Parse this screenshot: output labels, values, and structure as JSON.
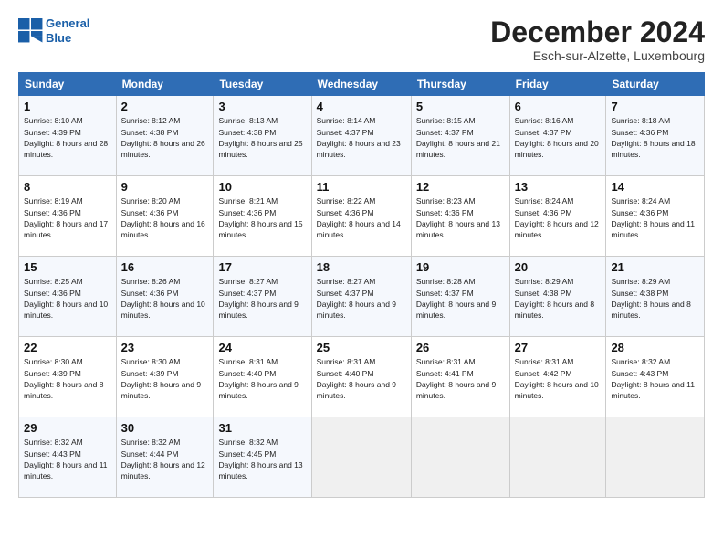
{
  "logo": {
    "line1": "General",
    "line2": "Blue"
  },
  "title": "December 2024",
  "subtitle": "Esch-sur-Alzette, Luxembourg",
  "days_of_week": [
    "Sunday",
    "Monday",
    "Tuesday",
    "Wednesday",
    "Thursday",
    "Friday",
    "Saturday"
  ],
  "weeks": [
    [
      {
        "day": "1",
        "sunrise": "8:10 AM",
        "sunset": "4:39 PM",
        "daylight": "8 hours and 28 minutes."
      },
      {
        "day": "2",
        "sunrise": "8:12 AM",
        "sunset": "4:38 PM",
        "daylight": "8 hours and 26 minutes."
      },
      {
        "day": "3",
        "sunrise": "8:13 AM",
        "sunset": "4:38 PM",
        "daylight": "8 hours and 25 minutes."
      },
      {
        "day": "4",
        "sunrise": "8:14 AM",
        "sunset": "4:37 PM",
        "daylight": "8 hours and 23 minutes."
      },
      {
        "day": "5",
        "sunrise": "8:15 AM",
        "sunset": "4:37 PM",
        "daylight": "8 hours and 21 minutes."
      },
      {
        "day": "6",
        "sunrise": "8:16 AM",
        "sunset": "4:37 PM",
        "daylight": "8 hours and 20 minutes."
      },
      {
        "day": "7",
        "sunrise": "8:18 AM",
        "sunset": "4:36 PM",
        "daylight": "8 hours and 18 minutes."
      }
    ],
    [
      {
        "day": "8",
        "sunrise": "8:19 AM",
        "sunset": "4:36 PM",
        "daylight": "8 hours and 17 minutes."
      },
      {
        "day": "9",
        "sunrise": "8:20 AM",
        "sunset": "4:36 PM",
        "daylight": "8 hours and 16 minutes."
      },
      {
        "day": "10",
        "sunrise": "8:21 AM",
        "sunset": "4:36 PM",
        "daylight": "8 hours and 15 minutes."
      },
      {
        "day": "11",
        "sunrise": "8:22 AM",
        "sunset": "4:36 PM",
        "daylight": "8 hours and 14 minutes."
      },
      {
        "day": "12",
        "sunrise": "8:23 AM",
        "sunset": "4:36 PM",
        "daylight": "8 hours and 13 minutes."
      },
      {
        "day": "13",
        "sunrise": "8:24 AM",
        "sunset": "4:36 PM",
        "daylight": "8 hours and 12 minutes."
      },
      {
        "day": "14",
        "sunrise": "8:24 AM",
        "sunset": "4:36 PM",
        "daylight": "8 hours and 11 minutes."
      }
    ],
    [
      {
        "day": "15",
        "sunrise": "8:25 AM",
        "sunset": "4:36 PM",
        "daylight": "8 hours and 10 minutes."
      },
      {
        "day": "16",
        "sunrise": "8:26 AM",
        "sunset": "4:36 PM",
        "daylight": "8 hours and 10 minutes."
      },
      {
        "day": "17",
        "sunrise": "8:27 AM",
        "sunset": "4:37 PM",
        "daylight": "8 hours and 9 minutes."
      },
      {
        "day": "18",
        "sunrise": "8:27 AM",
        "sunset": "4:37 PM",
        "daylight": "8 hours and 9 minutes."
      },
      {
        "day": "19",
        "sunrise": "8:28 AM",
        "sunset": "4:37 PM",
        "daylight": "8 hours and 9 minutes."
      },
      {
        "day": "20",
        "sunrise": "8:29 AM",
        "sunset": "4:38 PM",
        "daylight": "8 hours and 8 minutes."
      },
      {
        "day": "21",
        "sunrise": "8:29 AM",
        "sunset": "4:38 PM",
        "daylight": "8 hours and 8 minutes."
      }
    ],
    [
      {
        "day": "22",
        "sunrise": "8:30 AM",
        "sunset": "4:39 PM",
        "daylight": "8 hours and 8 minutes."
      },
      {
        "day": "23",
        "sunrise": "8:30 AM",
        "sunset": "4:39 PM",
        "daylight": "8 hours and 9 minutes."
      },
      {
        "day": "24",
        "sunrise": "8:31 AM",
        "sunset": "4:40 PM",
        "daylight": "8 hours and 9 minutes."
      },
      {
        "day": "25",
        "sunrise": "8:31 AM",
        "sunset": "4:40 PM",
        "daylight": "8 hours and 9 minutes."
      },
      {
        "day": "26",
        "sunrise": "8:31 AM",
        "sunset": "4:41 PM",
        "daylight": "8 hours and 9 minutes."
      },
      {
        "day": "27",
        "sunrise": "8:31 AM",
        "sunset": "4:42 PM",
        "daylight": "8 hours and 10 minutes."
      },
      {
        "day": "28",
        "sunrise": "8:32 AM",
        "sunset": "4:43 PM",
        "daylight": "8 hours and 11 minutes."
      }
    ],
    [
      {
        "day": "29",
        "sunrise": "8:32 AM",
        "sunset": "4:43 PM",
        "daylight": "8 hours and 11 minutes."
      },
      {
        "day": "30",
        "sunrise": "8:32 AM",
        "sunset": "4:44 PM",
        "daylight": "8 hours and 12 minutes."
      },
      {
        "day": "31",
        "sunrise": "8:32 AM",
        "sunset": "4:45 PM",
        "daylight": "8 hours and 13 minutes."
      },
      null,
      null,
      null,
      null
    ]
  ]
}
